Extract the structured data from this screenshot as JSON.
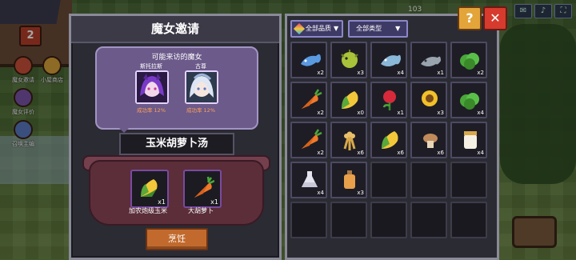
{
  "hud": {
    "level": "2",
    "coins": "103",
    "side_buttons": [
      "魔女邀请",
      "小屋商店",
      "魔女评价",
      "召唤主编"
    ]
  },
  "left_panel": {
    "title": "魔女邀请",
    "witch_heading": "可能来访的魔女",
    "witches": [
      {
        "name": "斯托拉斯",
        "rate": "成功率 12%",
        "color": "#6a3aa8"
      },
      {
        "name": "古尊",
        "rate": "成功率 12%",
        "color": "#9cb4d8"
      }
    ],
    "recipe_name": "玉米胡萝卜汤",
    "ingredients": [
      {
        "label": "加农炮级玉米",
        "qty": "x1",
        "icon": "corn-icon"
      },
      {
        "label": "大胡萝卜",
        "qty": "x1",
        "icon": "carrot-icon"
      }
    ],
    "cook_label": "烹饪"
  },
  "right_panel": {
    "filter_quality": "全部品质",
    "filter_type": "全部类型",
    "items": [
      {
        "icon": "fish-blue-icon",
        "qty": "x2"
      },
      {
        "icon": "pufferfish-icon",
        "qty": "x3"
      },
      {
        "icon": "fish-silver-icon",
        "qty": "x4"
      },
      {
        "icon": "fish-grey-icon",
        "qty": "x1"
      },
      {
        "icon": "lettuce-icon",
        "qty": "x2"
      },
      {
        "icon": "carrot-icon",
        "qty": "x2"
      },
      {
        "icon": "corn-icon",
        "qty": "x0"
      },
      {
        "icon": "rose-icon",
        "qty": "x1"
      },
      {
        "icon": "sunflower-icon",
        "qty": "x3"
      },
      {
        "icon": "lettuce-icon",
        "qty": "x4"
      },
      {
        "icon": "carrot-icon",
        "qty": "x2"
      },
      {
        "icon": "wheat-icon",
        "qty": "x6"
      },
      {
        "icon": "corn-icon",
        "qty": "x6"
      },
      {
        "icon": "mushroom-icon",
        "qty": "x6"
      },
      {
        "icon": "milk-jar-icon",
        "qty": "x4"
      },
      {
        "icon": "potion-white-icon",
        "qty": "x4"
      },
      {
        "icon": "potion-orange-icon",
        "qty": "x3"
      }
    ],
    "total_slots": 25
  },
  "colors": {
    "accent_orange": "#c26a2e",
    "close_red": "#d63b2e",
    "help_yellow": "#e3a43a",
    "witch_box": "#6b5a8a"
  }
}
